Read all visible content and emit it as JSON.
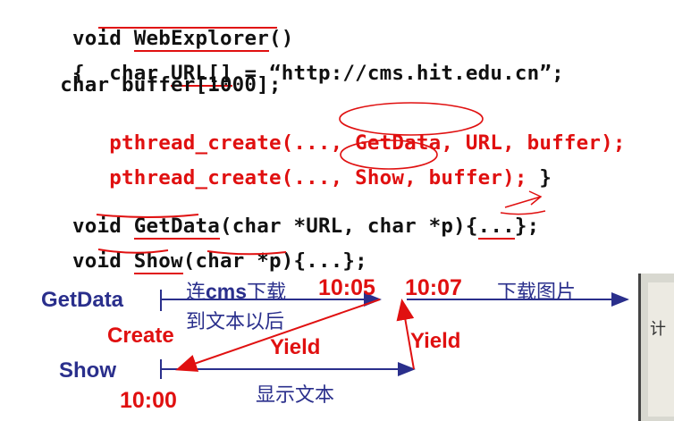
{
  "code": {
    "line1": {
      "kw": "void ",
      "fn": "WebExplorer",
      "rest": "()"
    },
    "line2": {
      "brace": "{  ",
      "kw": "char ",
      "var": "URL[]",
      "rest": " = “http://cms.hit.edu.cn”;"
    },
    "line3": {
      "text": "   char buffer[1000];"
    },
    "line4": {
      "a": "   pthread_create(...,",
      "b": " GetData",
      "c": ", URL, buffer);"
    },
    "line5": {
      "a": "   pthread_create(...,",
      "b": " Show,",
      "c": " buffer); ",
      "d": "}"
    },
    "line6": {
      "kw": "void ",
      "fn": "GetData",
      "rest": "(char *URL, char *p){",
      "dots": "...",
      "end": "};"
    },
    "line7": {
      "kw": "void ",
      "fn": "Show",
      "rest": "(char *p){...};"
    }
  },
  "diagram": {
    "thread1": "GetData",
    "thread2": "Show",
    "create": "Create",
    "yield1": "Yield",
    "yield2": "Yield",
    "t_start": "10:00",
    "t1": "10:05",
    "t2": "10:07",
    "cn_connect_pre": "连",
    "cn_connect_bold": "cms",
    "cn_connect_post": "下载",
    "cn_after_text": "到文本以后",
    "cn_download_img": "下载图片",
    "cn_show_text": "显示文本"
  },
  "colors": {
    "code": "#111111",
    "highlight": "#e01010",
    "diagram_blue": "#2a2f8c",
    "annotation": "#e01010"
  }
}
